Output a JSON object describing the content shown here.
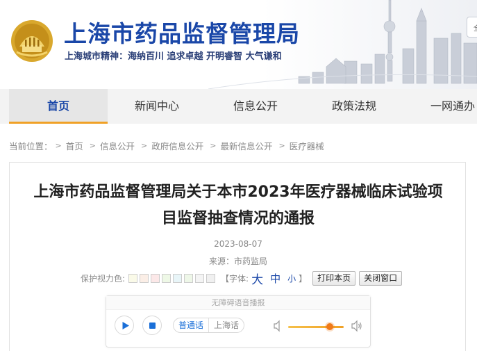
{
  "header": {
    "site_title": "上海市药品监督管理局",
    "slogan": "上海城市精神：海纳百川  追求卓越  开明睿智  大气谦和",
    "top_button_label": "全"
  },
  "nav": {
    "items": [
      {
        "label": "首页",
        "active": true
      },
      {
        "label": "新闻中心",
        "active": false
      },
      {
        "label": "信息公开",
        "active": false
      },
      {
        "label": "政策法规",
        "active": false
      },
      {
        "label": "一网通办",
        "active": false
      }
    ]
  },
  "breadcrumb": {
    "prefix": "当前位置：",
    "items": [
      "首页",
      "信息公开",
      "政府信息公开",
      "最新信息公开",
      "医疗器械"
    ],
    "separator": ">"
  },
  "article": {
    "title_line1": "上海市药品监督管理局关于本市2023年医疗器械临床试验项",
    "title_line2": "目监督抽查情况的通报",
    "date": "2023-08-07",
    "source": "来源：市药监局"
  },
  "tools": {
    "eye_color_label": "保护视力色:",
    "swatches": [
      "#fafae8",
      "#fbeee6",
      "#fce8e8",
      "#eef8e6",
      "#e8f5f8",
      "#eef7e8",
      "#f4f4f4",
      "#f0f0f0"
    ],
    "font_label": "【字体:",
    "font_big": "大",
    "font_mid": "中",
    "font_small": "小",
    "font_close": "】",
    "print_label": "打印本页",
    "close_label": "关闭窗口"
  },
  "player": {
    "title": "无障碍语音播报",
    "lang_active": "普通话",
    "lang_other": "上海话",
    "volume": 0.75
  },
  "colors": {
    "brand_blue": "#1a47a8",
    "accent_orange": "#f0a126",
    "player_blue": "#1a6fd8"
  }
}
